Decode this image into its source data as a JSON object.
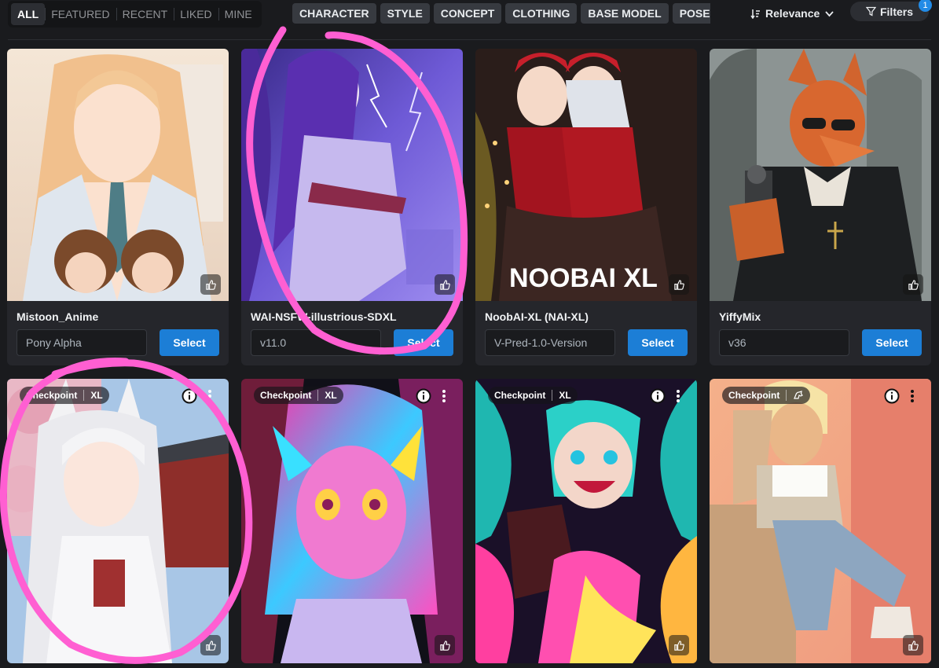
{
  "filter_tabs": [
    "ALL",
    "FEATURED",
    "RECENT",
    "LIKED",
    "MINE"
  ],
  "categories": [
    "CHARACTER",
    "STYLE",
    "CONCEPT",
    "CLOTHING",
    "BASE MODEL",
    "POSES"
  ],
  "sort": {
    "label": "Relevance"
  },
  "filters": {
    "label": "Filters",
    "count": "1"
  },
  "cards_row1": [
    {
      "title": "Mistoon_Anime",
      "version": "Pony Alpha",
      "select": "Select"
    },
    {
      "title": "WAI-NSFW-illustrious-SDXL",
      "version": "v11.0",
      "select": "Select"
    },
    {
      "title": "NoobAI-XL (NAI-XL)",
      "version": "V-Pred-1.0-Version",
      "select": "Select",
      "overlay": "NOOBAI XL"
    },
    {
      "title": "YiffyMix",
      "version": "v36",
      "select": "Select"
    }
  ],
  "cards_row2": [
    {
      "type": "Checkpoint",
      "base": "XL"
    },
    {
      "type": "Checkpoint",
      "base": "XL"
    },
    {
      "type": "Checkpoint",
      "base": "XL"
    },
    {
      "type": "Checkpoint",
      "base": "pony-icon"
    }
  ],
  "colors": {
    "accent": "#1c7ed6",
    "card": "#25262b",
    "background": "#1a1b1e",
    "annotation": "#ff5fd2"
  }
}
